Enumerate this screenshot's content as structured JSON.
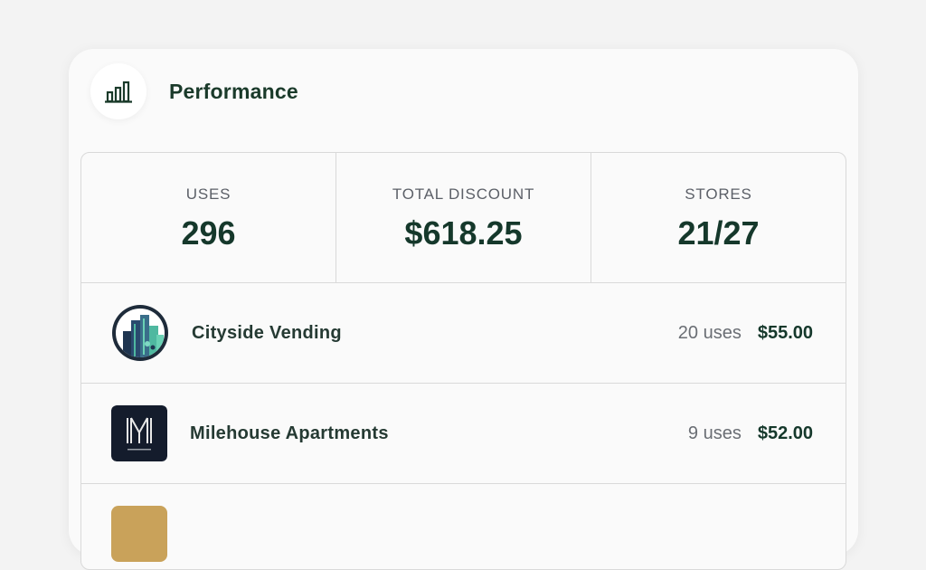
{
  "header": {
    "title": "Performance",
    "icon": "bar-chart-icon"
  },
  "stats": [
    {
      "label": "USES",
      "value": "296"
    },
    {
      "label": "TOTAL DISCOUNT",
      "value": "$618.25"
    },
    {
      "label": "STORES",
      "value": "21/27"
    }
  ],
  "rows": [
    {
      "name": "Cityside Vending",
      "uses": "20 uses",
      "amount": "$55.00",
      "logo": "cityside-vending-logo"
    },
    {
      "name": "Milehouse Apartments",
      "uses": "9 uses",
      "amount": "$52.00",
      "logo": "milehouse-apartments-logo"
    }
  ],
  "colors": {
    "accent": "#15382b",
    "muted": "#5c6068",
    "border": "#d9d9d9"
  }
}
